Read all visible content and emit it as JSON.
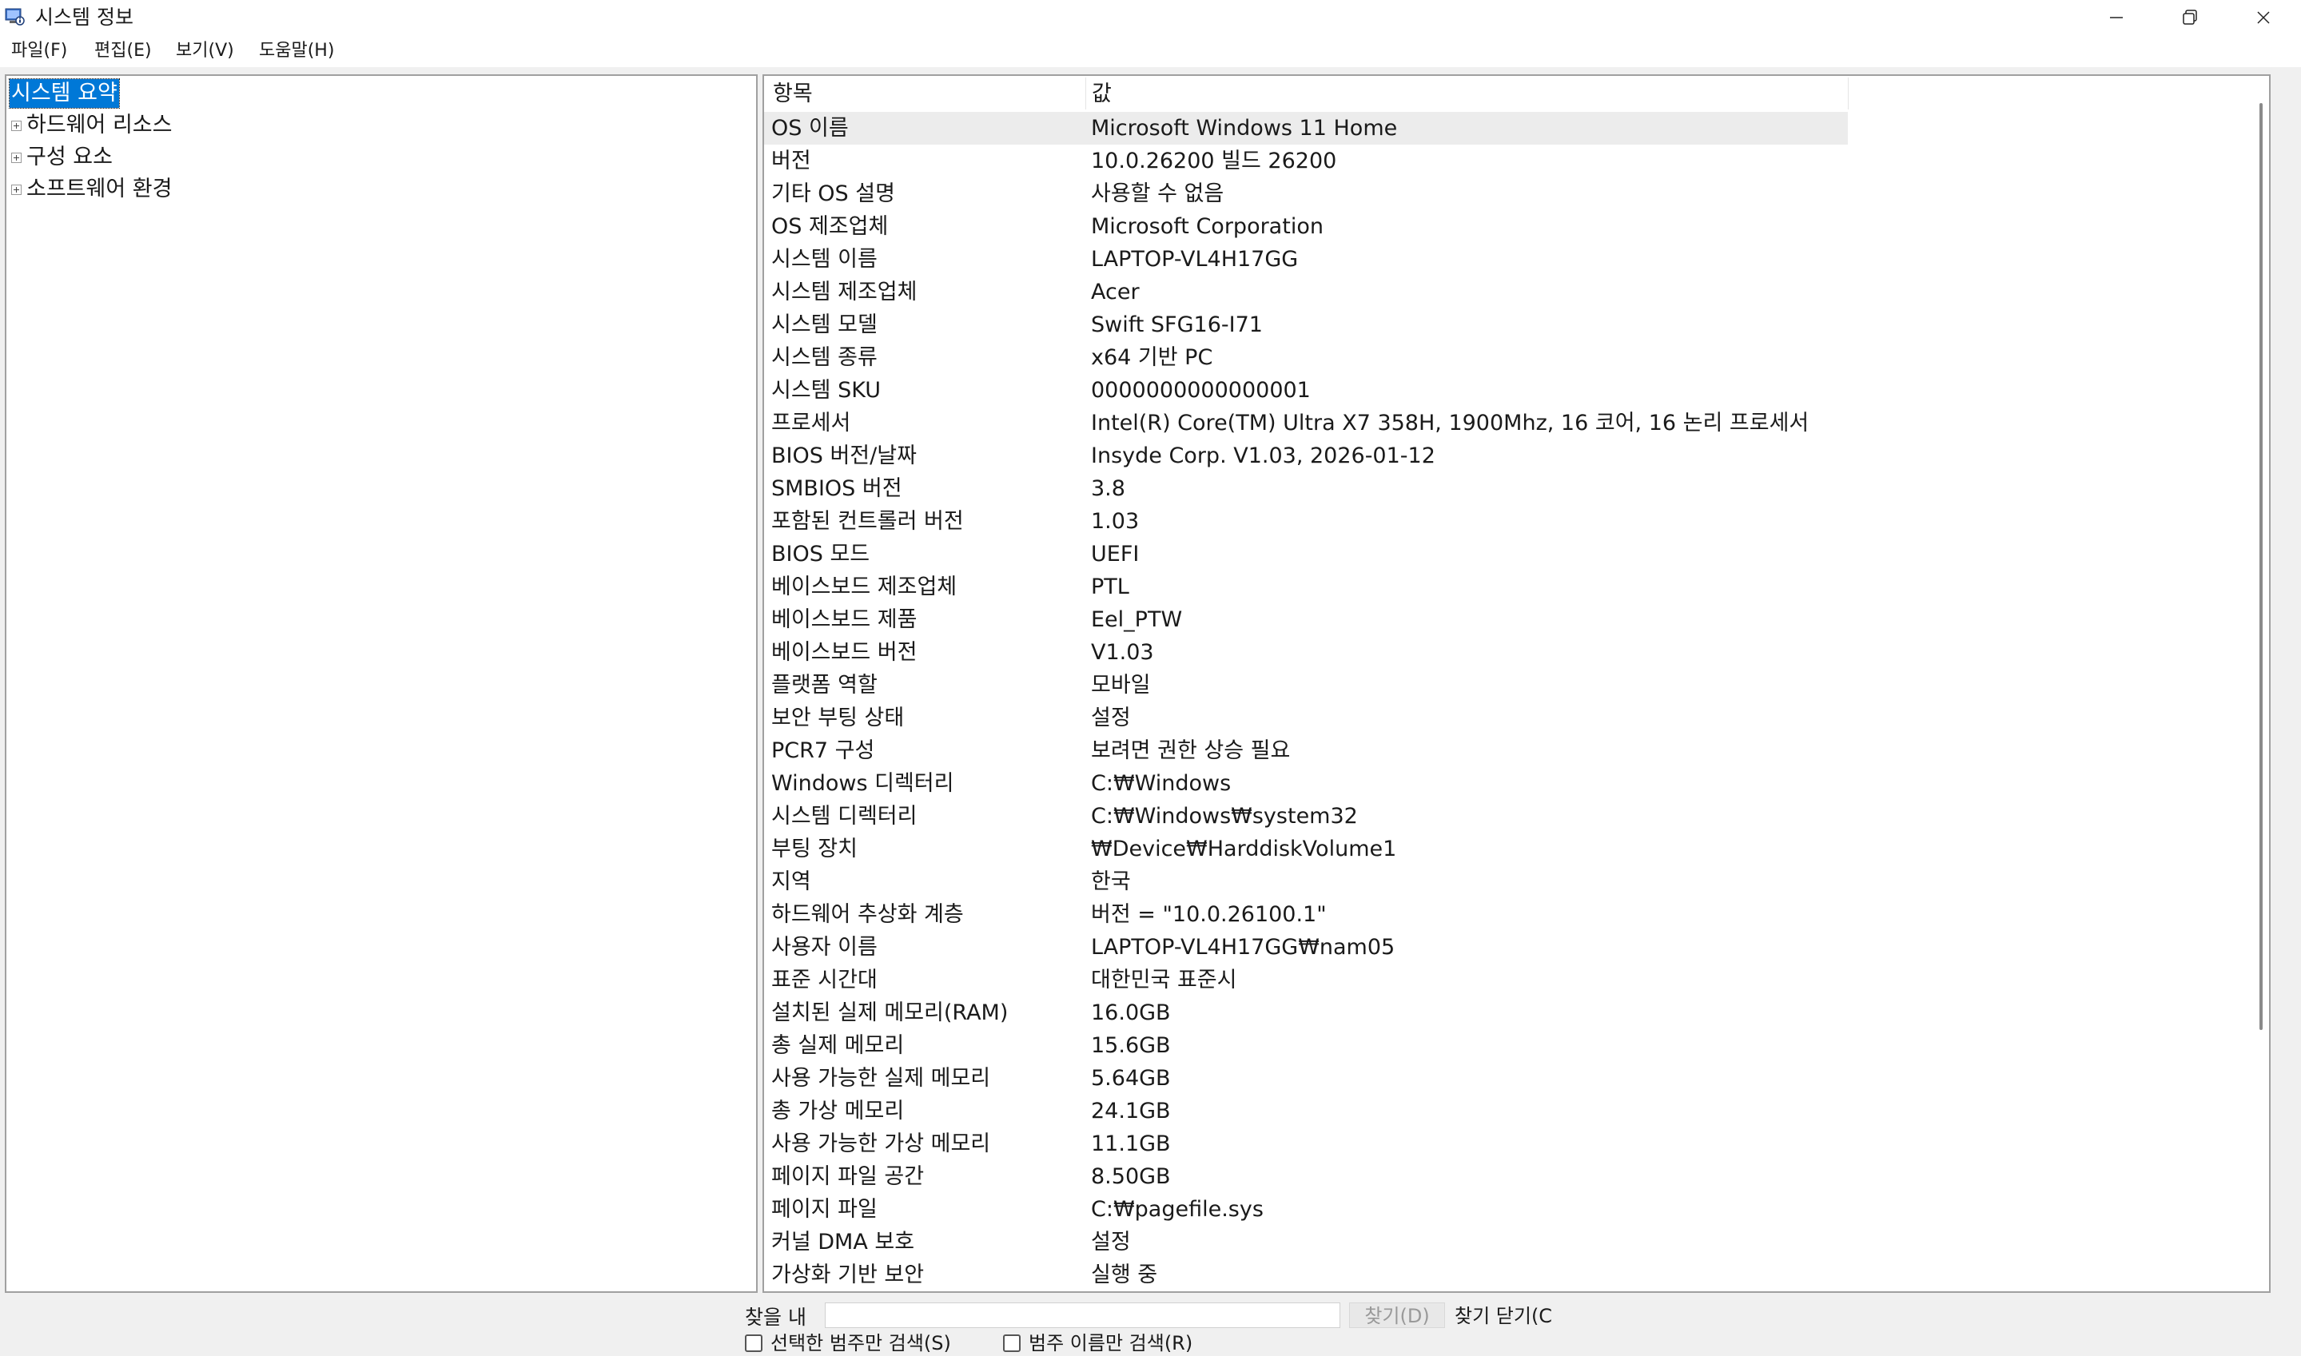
{
  "window": {
    "title": "시스템 정보",
    "controls": {
      "minimize": "minimize-icon",
      "maximize": "restore-icon",
      "close": "close-icon"
    }
  },
  "menu": [
    {
      "label": "파일(F)"
    },
    {
      "label": "편집(E)"
    },
    {
      "label": "보기(V)"
    },
    {
      "label": "도움말(H)"
    }
  ],
  "tree": {
    "items": [
      {
        "label": "시스템 요약",
        "selected": true,
        "expandable": false
      },
      {
        "label": "하드웨어 리소스",
        "expandable": true
      },
      {
        "label": "구성 요소",
        "expandable": true
      },
      {
        "label": "소프트웨어 환경",
        "expandable": true
      }
    ]
  },
  "details": {
    "headers": {
      "item": "항목",
      "value": "값"
    },
    "rows": [
      {
        "item": "OS 이름",
        "value": "Microsoft Windows 11 Home"
      },
      {
        "item": "버전",
        "value": "10.0.26200 빌드 26200"
      },
      {
        "item": "기타 OS 설명",
        "value": "사용할 수 없음"
      },
      {
        "item": "OS 제조업체",
        "value": "Microsoft Corporation"
      },
      {
        "item": "시스템 이름",
        "value": "LAPTOP-VL4H17GG"
      },
      {
        "item": "시스템 제조업체",
        "value": "Acer"
      },
      {
        "item": "시스템 모델",
        "value": "Swift SFG16-I71"
      },
      {
        "item": "시스템 종류",
        "value": "x64 기반 PC"
      },
      {
        "item": "시스템 SKU",
        "value": "0000000000000001"
      },
      {
        "item": "프로세서",
        "value": "Intel(R) Core(TM) Ultra X7 358H, 1900Mhz, 16 코어, 16 논리 프로세서"
      },
      {
        "item": "BIOS 버전/날짜",
        "value": "Insyde Corp. V1.03, 2026-01-12"
      },
      {
        "item": "SMBIOS 버전",
        "value": "3.8"
      },
      {
        "item": "포함된 컨트롤러 버전",
        "value": "1.03"
      },
      {
        "item": "BIOS 모드",
        "value": "UEFI"
      },
      {
        "item": "베이스보드 제조업체",
        "value": "PTL"
      },
      {
        "item": "베이스보드 제품",
        "value": "Eel_PTW"
      },
      {
        "item": "베이스보드 버전",
        "value": "V1.03"
      },
      {
        "item": "플랫폼 역할",
        "value": "모바일"
      },
      {
        "item": "보안 부팅 상태",
        "value": "설정"
      },
      {
        "item": "PCR7 구성",
        "value": "보려면 권한 상승 필요"
      },
      {
        "item": "Windows 디렉터리",
        "value": "C:₩Windows"
      },
      {
        "item": "시스템 디렉터리",
        "value": "C:₩Windows₩system32"
      },
      {
        "item": "부팅 장치",
        "value": "₩Device₩HarddiskVolume1"
      },
      {
        "item": "지역",
        "value": "한국"
      },
      {
        "item": "하드웨어 추상화 계층",
        "value": "버전 = \"10.0.26100.1\""
      },
      {
        "item": "사용자 이름",
        "value": "LAPTOP-VL4H17GG₩nam05"
      },
      {
        "item": "표준 시간대",
        "value": "대한민국 표준시"
      },
      {
        "item": "설치된 실제 메모리(RAM)",
        "value": "16.0GB"
      },
      {
        "item": "총 실제 메모리",
        "value": "15.6GB"
      },
      {
        "item": "사용 가능한 실제 메모리",
        "value": "5.64GB"
      },
      {
        "item": "총 가상 메모리",
        "value": "24.1GB"
      },
      {
        "item": "사용 가능한 가상 메모리",
        "value": "11.1GB"
      },
      {
        "item": "페이지 파일 공간",
        "value": "8.50GB"
      },
      {
        "item": "페이지 파일",
        "value": "C:₩pagefile.sys"
      },
      {
        "item": "커널 DMA 보호",
        "value": "설정"
      },
      {
        "item": "가상화 기반 보안",
        "value": "실행 중"
      }
    ]
  },
  "findbar": {
    "label": "찾을 내",
    "input_value": "",
    "find_button": "찾기(D)",
    "close_find": "찾기 닫기(C",
    "checkbox_selected_only": "선택한 범주만 검색(S)",
    "checkbox_names_only": "범주 이름만 검색(R)"
  }
}
